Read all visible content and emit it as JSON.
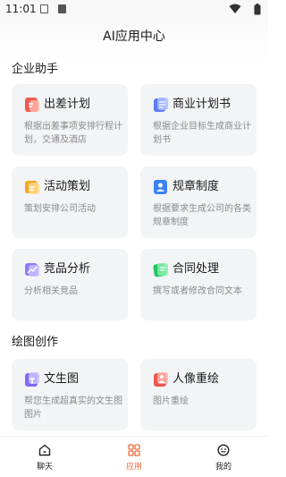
{
  "status_bar": {
    "time": "11:01"
  },
  "header": {
    "title": "AI应用中心"
  },
  "sections": [
    {
      "title": "企业助手",
      "cards": [
        {
          "title": "出差计划",
          "desc": "根据出差事项安排行程计划，交通及酒店",
          "icon": "travel-plan-icon"
        },
        {
          "title": "商业计划书",
          "desc": "根据企业目标生成商业计划书",
          "icon": "business-plan-icon"
        },
        {
          "title": "活动策划",
          "desc": "策划安排公司活动",
          "icon": "event-planning-icon"
        },
        {
          "title": "规章制度",
          "desc": "根据要求生成公司的各类规章制度",
          "icon": "regulations-icon"
        },
        {
          "title": "竞品分析",
          "desc": "分析相关竞品",
          "icon": "competitor-analysis-icon"
        },
        {
          "title": "合同处理",
          "desc": "撰写或者修改合同文本",
          "icon": "contract-icon"
        }
      ]
    },
    {
      "title": "绘图创作",
      "cards": [
        {
          "title": "文生图",
          "desc": "帮您生成超真实的文生图图片",
          "icon": "text-to-image-icon"
        },
        {
          "title": "人像重绘",
          "desc": "图片重绘",
          "icon": "portrait-redraw-icon"
        }
      ]
    }
  ],
  "tabbar": {
    "tabs": [
      {
        "label": "聊天",
        "icon": "home-icon"
      },
      {
        "label": "应用",
        "icon": "apps-grid-icon",
        "active": true
      },
      {
        "label": "我的",
        "icon": "profile-face-icon"
      }
    ]
  },
  "colors": {
    "accent": "#ef6a3a",
    "card_bg": "#f3f4f6",
    "desc_text": "#8a8a8a"
  }
}
